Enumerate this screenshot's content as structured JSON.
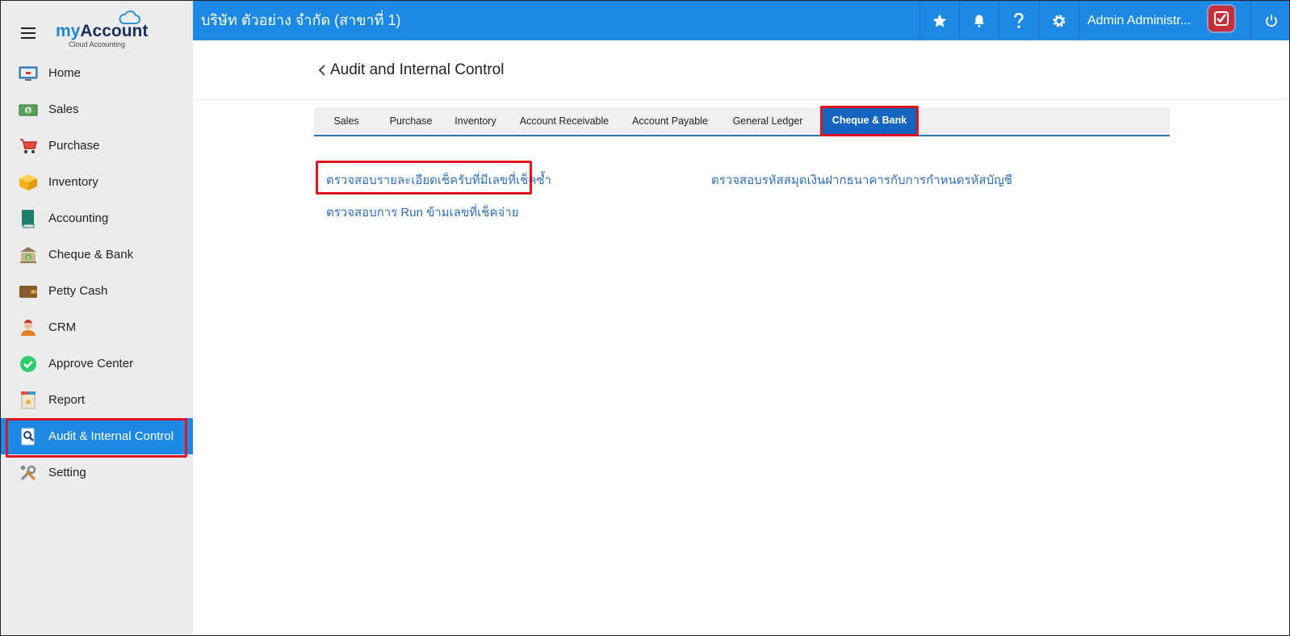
{
  "brand": {
    "logo_my": "my",
    "logo_account": "Account",
    "logo_sub": "Cloud Accounting"
  },
  "sidebar": {
    "items": [
      {
        "label": "Home",
        "icon": "home-screen-icon"
      },
      {
        "label": "Sales",
        "icon": "money-icon"
      },
      {
        "label": "Purchase",
        "icon": "cart-icon"
      },
      {
        "label": "Inventory",
        "icon": "box-icon"
      },
      {
        "label": "Accounting",
        "icon": "ledger-book-icon"
      },
      {
        "label": "Cheque & Bank",
        "icon": "bank-icon"
      },
      {
        "label": "Petty Cash",
        "icon": "wallet-icon"
      },
      {
        "label": "CRM",
        "icon": "customer-icon"
      },
      {
        "label": "Approve Center",
        "icon": "check-circle-icon"
      },
      {
        "label": "Report",
        "icon": "report-icon"
      },
      {
        "label": "Audit & Internal Control",
        "icon": "audit-magnifier-icon"
      },
      {
        "label": "Setting",
        "icon": "tools-icon"
      }
    ],
    "active_index": 10
  },
  "topbar": {
    "company": "บริษัท ตัวอย่าง จำกัด (สาขาที่ 1)",
    "username": "Admin Administr...",
    "icons": [
      "star-icon",
      "bell-icon",
      "help-icon",
      "gear-icon",
      "power-icon"
    ]
  },
  "header": {
    "title": "Audit and Internal Control"
  },
  "tabs": [
    {
      "label": "Sales"
    },
    {
      "label": "Purchase"
    },
    {
      "label": "Inventory"
    },
    {
      "label": "Account Receivable"
    },
    {
      "label": "Account Payable"
    },
    {
      "label": "General Ledger"
    },
    {
      "label": "Cheque & Bank"
    }
  ],
  "active_tab": 6,
  "links": {
    "duplicate_cheque": "ตรวจสอบรายละเอียดเช็ครับที่มีเลขที่เช็คซ้ำ",
    "skip_run_cheque": "ตรวจสอบการ Run ข้ามเลขที่เช็คจ่าย",
    "bank_book_account": "ตรวจสอบรหัสสมุดเงินฝากธนาคารกับการกำหนดรหัสบัญชี"
  },
  "colors": {
    "primary": "#1e88e5",
    "active_tab": "#1565c0",
    "highlight": "#e0141e",
    "link": "#2f6fb5"
  }
}
